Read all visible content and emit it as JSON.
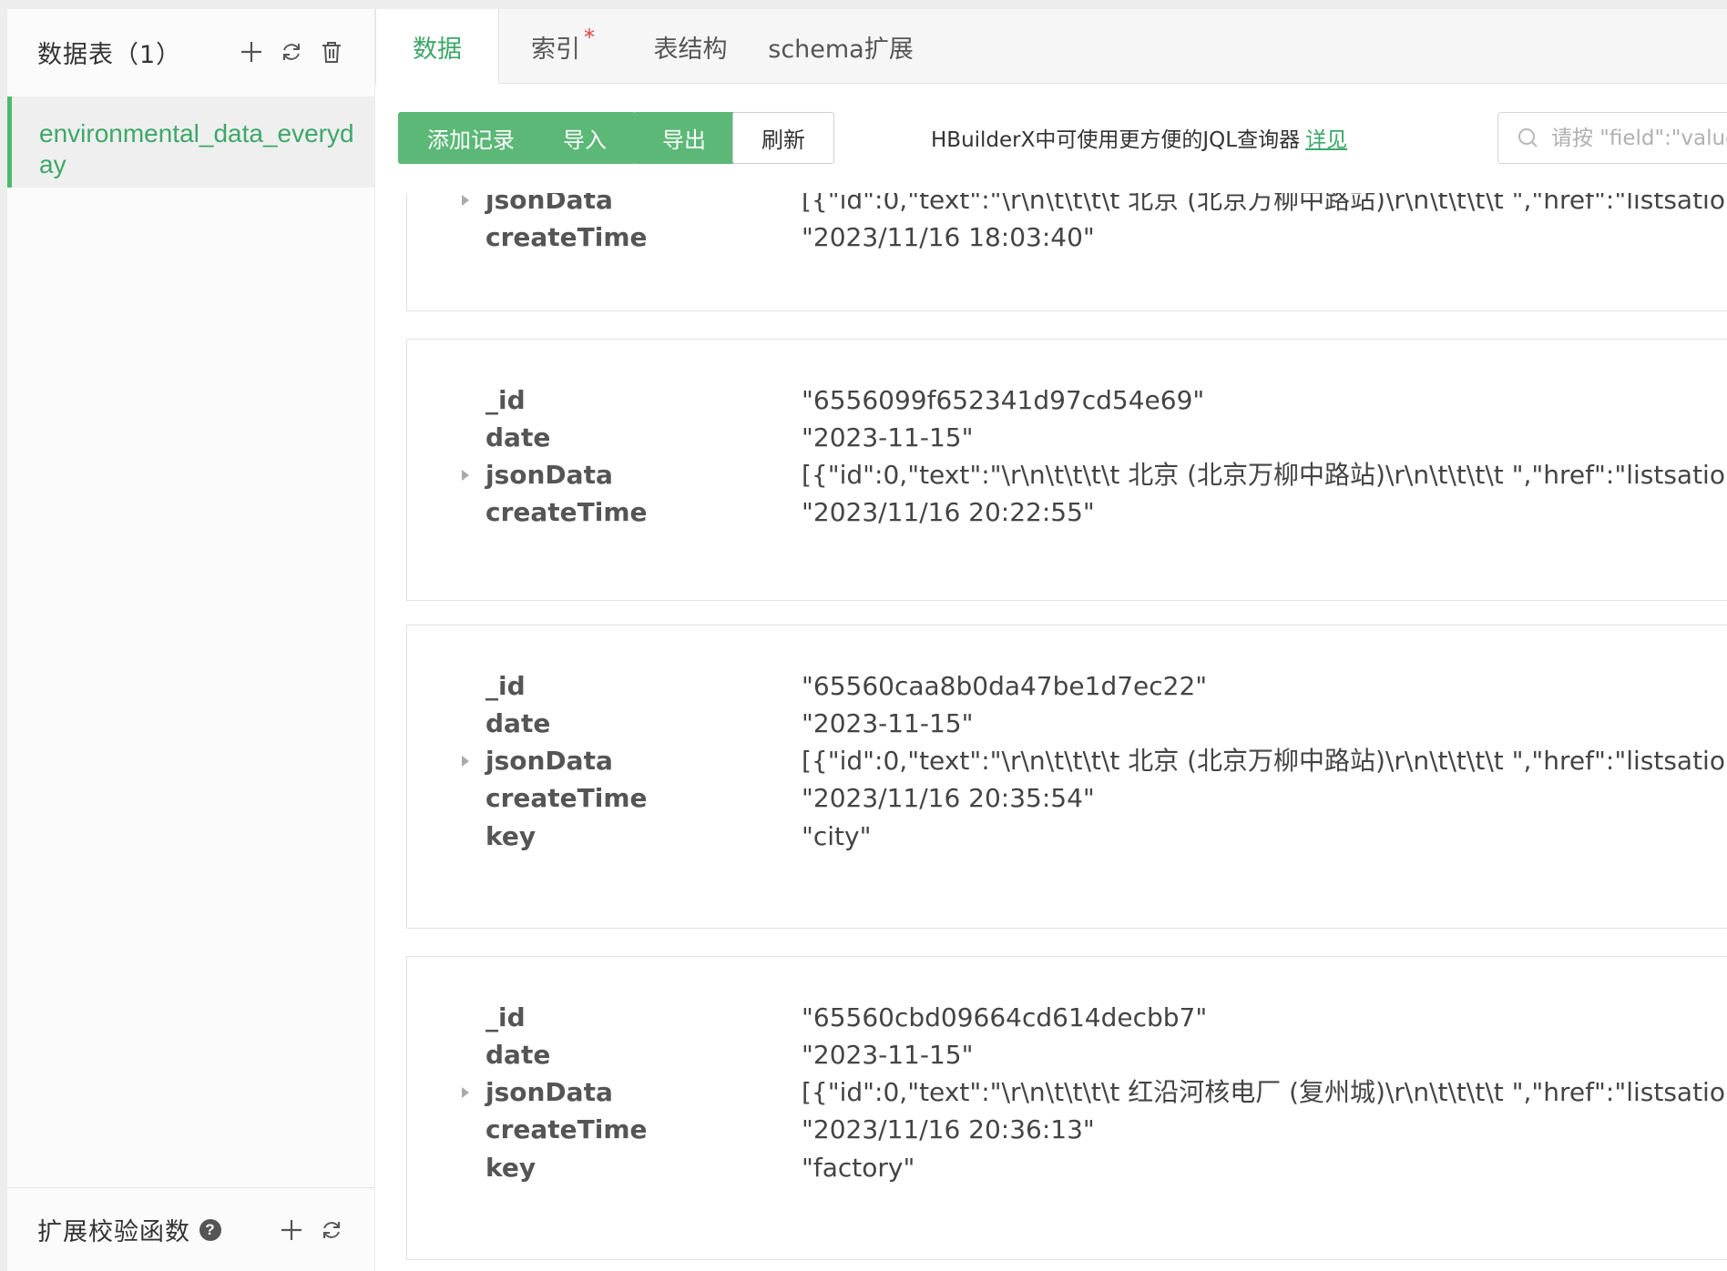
{
  "sidebar": {
    "title": "数据表（1）",
    "item": "environmental_data_everyday",
    "footer_title": "扩展校验函数",
    "help": "?"
  },
  "tabs": [
    {
      "label": "数据",
      "active": true
    },
    {
      "label": "索引",
      "modified": true
    },
    {
      "label": "表结构"
    },
    {
      "label": "schema扩展"
    }
  ],
  "tab_modified_mark": "*",
  "toolbar": {
    "add_record": "添加记录",
    "import": "导入",
    "export": "导出",
    "refresh": "刷新",
    "hint_text": "HBuilderX中可使用更方便的JQL查询器",
    "hint_link": "详见",
    "search_placeholder": "请按 \"field\":\"value\" 格式输入"
  },
  "records": [
    {
      "fields": [
        {
          "key": "jsonData",
          "value": "[{\"id\":0,\"text\":\"\\r\\n\\t\\t\\t\\t 北京 (北京万柳中路站)\\r\\n\\t\\t\\t\\t \",\"href\":\"listsatio...",
          "expandable": true
        },
        {
          "key": "createTime",
          "value": "\"2023/11/16 18:03:40\""
        }
      ]
    },
    {
      "fields": [
        {
          "key": "_id",
          "value": "\"6556099f652341d97cd54e69\""
        },
        {
          "key": "date",
          "value": "\"2023-11-15\""
        },
        {
          "key": "jsonData",
          "value": "[{\"id\":0,\"text\":\"\\r\\n\\t\\t\\t\\t 北京 (北京万柳中路站)\\r\\n\\t\\t\\t\\t \",\"href\":\"listsatio...",
          "expandable": true
        },
        {
          "key": "createTime",
          "value": "\"2023/11/16 20:22:55\""
        }
      ]
    },
    {
      "fields": [
        {
          "key": "_id",
          "value": "\"65560caa8b0da47be1d7ec22\""
        },
        {
          "key": "date",
          "value": "\"2023-11-15\""
        },
        {
          "key": "jsonData",
          "value": "[{\"id\":0,\"text\":\"\\r\\n\\t\\t\\t\\t 北京 (北京万柳中路站)\\r\\n\\t\\t\\t\\t \",\"href\":\"listsatio...",
          "expandable": true
        },
        {
          "key": "createTime",
          "value": "\"2023/11/16 20:35:54\""
        },
        {
          "key": "key",
          "value": "\"city\""
        }
      ]
    },
    {
      "fields": [
        {
          "key": "_id",
          "value": "\"65560cbd09664cd614decbb7\""
        },
        {
          "key": "date",
          "value": "\"2023-11-15\""
        },
        {
          "key": "jsonData",
          "value": "[{\"id\":0,\"text\":\"\\r\\n\\t\\t\\t\\t 红沿河核电厂 (复州城)\\r\\n\\t\\t\\t\\t \",\"href\":\"listsatio...",
          "expandable": true
        },
        {
          "key": "createTime",
          "value": "\"2023/11/16 20:36:13\""
        },
        {
          "key": "key",
          "value": "\"factory\""
        }
      ]
    }
  ],
  "colors": {
    "accent": "#3ca867",
    "button_green": "#5cb877",
    "modified_star": "#e04040"
  }
}
